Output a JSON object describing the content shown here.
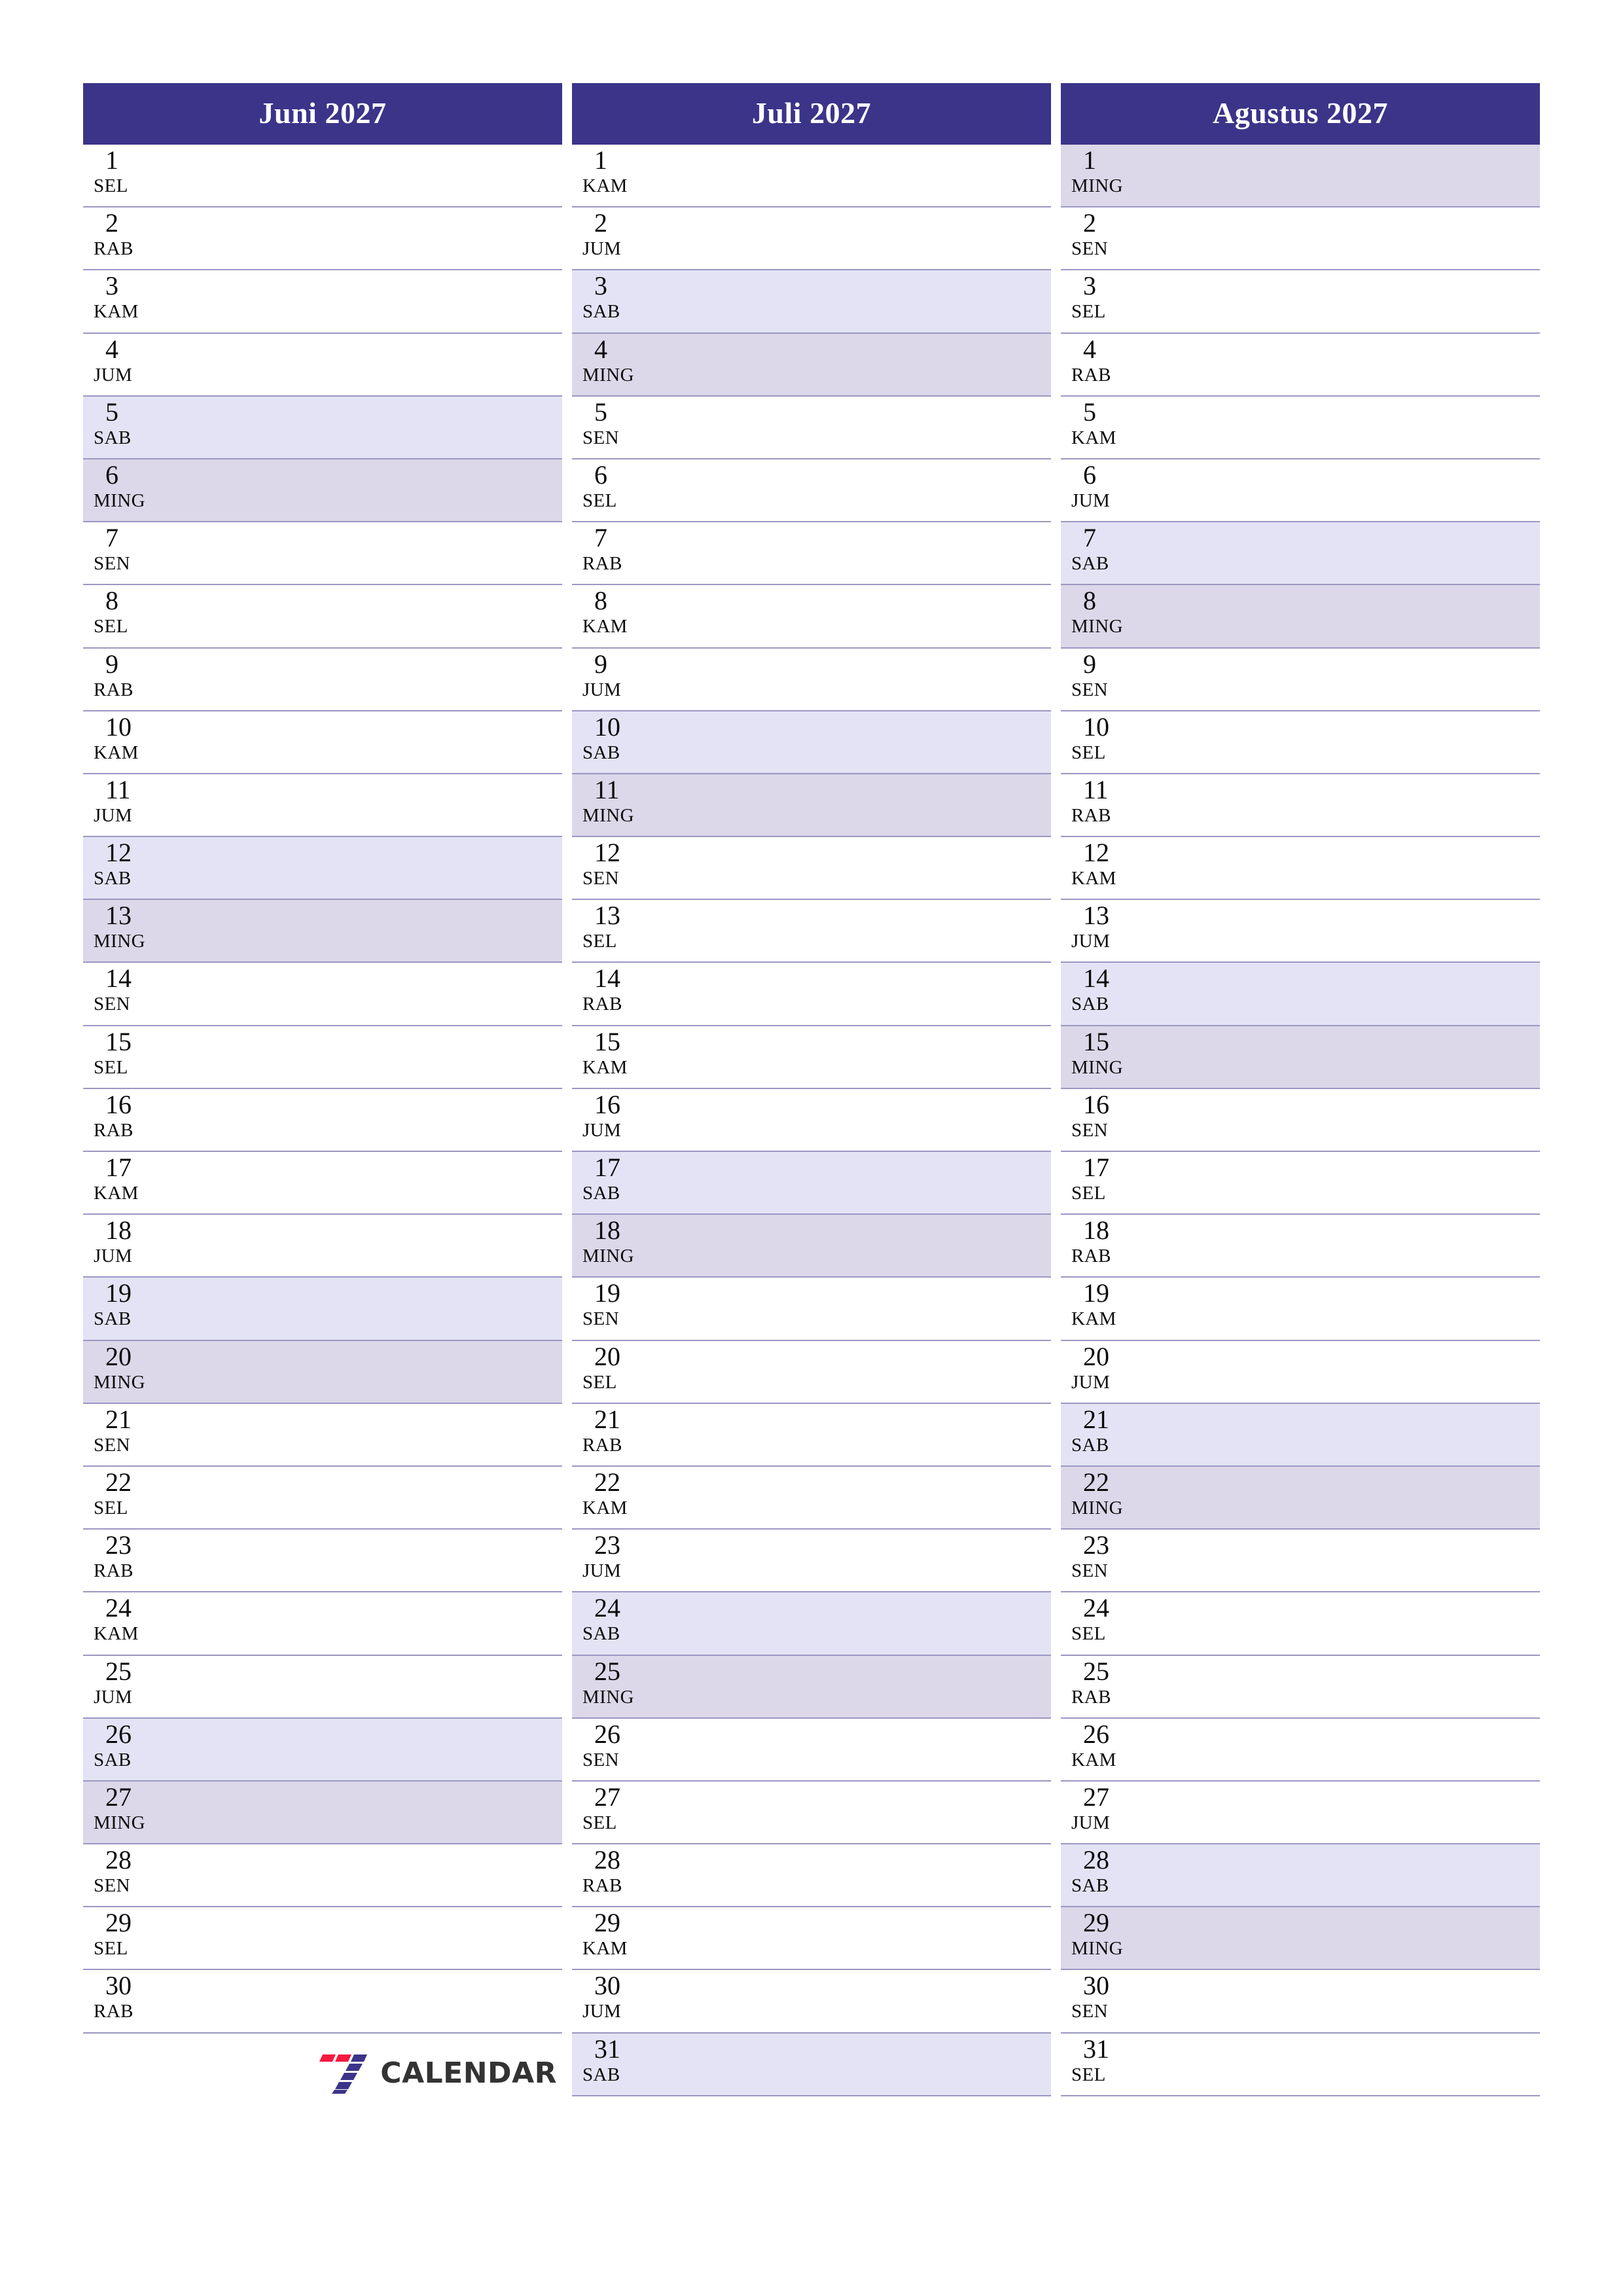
{
  "theme": {
    "header_bg": "#3b3489",
    "header_text": "#ffffff",
    "saturday_bg": "#e3e3f5",
    "sunday_bg": "#dcd7e9",
    "rule_color": "#9b97c2",
    "day_text": "#0a0a0a",
    "logo_red": "#f5183f",
    "logo_blue": "#3b3489",
    "logo_word": "#333333"
  },
  "logo": {
    "word": "CALENDAR",
    "mark": "seven-logo"
  },
  "months": [
    {
      "title": "Juni 2027",
      "days": [
        {
          "num": "1",
          "abbr": "SEL",
          "kind": "weekday"
        },
        {
          "num": "2",
          "abbr": "RAB",
          "kind": "weekday"
        },
        {
          "num": "3",
          "abbr": "KAM",
          "kind": "weekday"
        },
        {
          "num": "4",
          "abbr": "JUM",
          "kind": "weekday"
        },
        {
          "num": "5",
          "abbr": "SAB",
          "kind": "sat"
        },
        {
          "num": "6",
          "abbr": "MING",
          "kind": "sun"
        },
        {
          "num": "7",
          "abbr": "SEN",
          "kind": "weekday"
        },
        {
          "num": "8",
          "abbr": "SEL",
          "kind": "weekday"
        },
        {
          "num": "9",
          "abbr": "RAB",
          "kind": "weekday"
        },
        {
          "num": "10",
          "abbr": "KAM",
          "kind": "weekday"
        },
        {
          "num": "11",
          "abbr": "JUM",
          "kind": "weekday"
        },
        {
          "num": "12",
          "abbr": "SAB",
          "kind": "sat"
        },
        {
          "num": "13",
          "abbr": "MING",
          "kind": "sun"
        },
        {
          "num": "14",
          "abbr": "SEN",
          "kind": "weekday"
        },
        {
          "num": "15",
          "abbr": "SEL",
          "kind": "weekday"
        },
        {
          "num": "16",
          "abbr": "RAB",
          "kind": "weekday"
        },
        {
          "num": "17",
          "abbr": "KAM",
          "kind": "weekday"
        },
        {
          "num": "18",
          "abbr": "JUM",
          "kind": "weekday"
        },
        {
          "num": "19",
          "abbr": "SAB",
          "kind": "sat"
        },
        {
          "num": "20",
          "abbr": "MING",
          "kind": "sun"
        },
        {
          "num": "21",
          "abbr": "SEN",
          "kind": "weekday"
        },
        {
          "num": "22",
          "abbr": "SEL",
          "kind": "weekday"
        },
        {
          "num": "23",
          "abbr": "RAB",
          "kind": "weekday"
        },
        {
          "num": "24",
          "abbr": "KAM",
          "kind": "weekday"
        },
        {
          "num": "25",
          "abbr": "JUM",
          "kind": "weekday"
        },
        {
          "num": "26",
          "abbr": "SAB",
          "kind": "sat"
        },
        {
          "num": "27",
          "abbr": "MING",
          "kind": "sun"
        },
        {
          "num": "28",
          "abbr": "SEN",
          "kind": "weekday"
        },
        {
          "num": "29",
          "abbr": "SEL",
          "kind": "weekday"
        },
        {
          "num": "30",
          "abbr": "RAB",
          "kind": "weekday"
        }
      ]
    },
    {
      "title": "Juli 2027",
      "days": [
        {
          "num": "1",
          "abbr": "KAM",
          "kind": "weekday"
        },
        {
          "num": "2",
          "abbr": "JUM",
          "kind": "weekday"
        },
        {
          "num": "3",
          "abbr": "SAB",
          "kind": "sat"
        },
        {
          "num": "4",
          "abbr": "MING",
          "kind": "sun"
        },
        {
          "num": "5",
          "abbr": "SEN",
          "kind": "weekday"
        },
        {
          "num": "6",
          "abbr": "SEL",
          "kind": "weekday"
        },
        {
          "num": "7",
          "abbr": "RAB",
          "kind": "weekday"
        },
        {
          "num": "8",
          "abbr": "KAM",
          "kind": "weekday"
        },
        {
          "num": "9",
          "abbr": "JUM",
          "kind": "weekday"
        },
        {
          "num": "10",
          "abbr": "SAB",
          "kind": "sat"
        },
        {
          "num": "11",
          "abbr": "MING",
          "kind": "sun"
        },
        {
          "num": "12",
          "abbr": "SEN",
          "kind": "weekday"
        },
        {
          "num": "13",
          "abbr": "SEL",
          "kind": "weekday"
        },
        {
          "num": "14",
          "abbr": "RAB",
          "kind": "weekday"
        },
        {
          "num": "15",
          "abbr": "KAM",
          "kind": "weekday"
        },
        {
          "num": "16",
          "abbr": "JUM",
          "kind": "weekday"
        },
        {
          "num": "17",
          "abbr": "SAB",
          "kind": "sat"
        },
        {
          "num": "18",
          "abbr": "MING",
          "kind": "sun"
        },
        {
          "num": "19",
          "abbr": "SEN",
          "kind": "weekday"
        },
        {
          "num": "20",
          "abbr": "SEL",
          "kind": "weekday"
        },
        {
          "num": "21",
          "abbr": "RAB",
          "kind": "weekday"
        },
        {
          "num": "22",
          "abbr": "KAM",
          "kind": "weekday"
        },
        {
          "num": "23",
          "abbr": "JUM",
          "kind": "weekday"
        },
        {
          "num": "24",
          "abbr": "SAB",
          "kind": "sat"
        },
        {
          "num": "25",
          "abbr": "MING",
          "kind": "sun"
        },
        {
          "num": "26",
          "abbr": "SEN",
          "kind": "weekday"
        },
        {
          "num": "27",
          "abbr": "SEL",
          "kind": "weekday"
        },
        {
          "num": "28",
          "abbr": "RAB",
          "kind": "weekday"
        },
        {
          "num": "29",
          "abbr": "KAM",
          "kind": "weekday"
        },
        {
          "num": "30",
          "abbr": "JUM",
          "kind": "weekday"
        },
        {
          "num": "31",
          "abbr": "SAB",
          "kind": "sat"
        }
      ]
    },
    {
      "title": "Agustus 2027",
      "days": [
        {
          "num": "1",
          "abbr": "MING",
          "kind": "sun"
        },
        {
          "num": "2",
          "abbr": "SEN",
          "kind": "weekday"
        },
        {
          "num": "3",
          "abbr": "SEL",
          "kind": "weekday"
        },
        {
          "num": "4",
          "abbr": "RAB",
          "kind": "weekday"
        },
        {
          "num": "5",
          "abbr": "KAM",
          "kind": "weekday"
        },
        {
          "num": "6",
          "abbr": "JUM",
          "kind": "weekday"
        },
        {
          "num": "7",
          "abbr": "SAB",
          "kind": "sat"
        },
        {
          "num": "8",
          "abbr": "MING",
          "kind": "sun"
        },
        {
          "num": "9",
          "abbr": "SEN",
          "kind": "weekday"
        },
        {
          "num": "10",
          "abbr": "SEL",
          "kind": "weekday"
        },
        {
          "num": "11",
          "abbr": "RAB",
          "kind": "weekday"
        },
        {
          "num": "12",
          "abbr": "KAM",
          "kind": "weekday"
        },
        {
          "num": "13",
          "abbr": "JUM",
          "kind": "weekday"
        },
        {
          "num": "14",
          "abbr": "SAB",
          "kind": "sat"
        },
        {
          "num": "15",
          "abbr": "MING",
          "kind": "sun"
        },
        {
          "num": "16",
          "abbr": "SEN",
          "kind": "weekday"
        },
        {
          "num": "17",
          "abbr": "SEL",
          "kind": "weekday"
        },
        {
          "num": "18",
          "abbr": "RAB",
          "kind": "weekday"
        },
        {
          "num": "19",
          "abbr": "KAM",
          "kind": "weekday"
        },
        {
          "num": "20",
          "abbr": "JUM",
          "kind": "weekday"
        },
        {
          "num": "21",
          "abbr": "SAB",
          "kind": "sat"
        },
        {
          "num": "22",
          "abbr": "MING",
          "kind": "sun"
        },
        {
          "num": "23",
          "abbr": "SEN",
          "kind": "weekday"
        },
        {
          "num": "24",
          "abbr": "SEL",
          "kind": "weekday"
        },
        {
          "num": "25",
          "abbr": "RAB",
          "kind": "weekday"
        },
        {
          "num": "26",
          "abbr": "KAM",
          "kind": "weekday"
        },
        {
          "num": "27",
          "abbr": "JUM",
          "kind": "weekday"
        },
        {
          "num": "28",
          "abbr": "SAB",
          "kind": "sat"
        },
        {
          "num": "29",
          "abbr": "MING",
          "kind": "sun"
        },
        {
          "num": "30",
          "abbr": "SEN",
          "kind": "weekday"
        },
        {
          "num": "31",
          "abbr": "SEL",
          "kind": "weekday"
        }
      ]
    }
  ]
}
